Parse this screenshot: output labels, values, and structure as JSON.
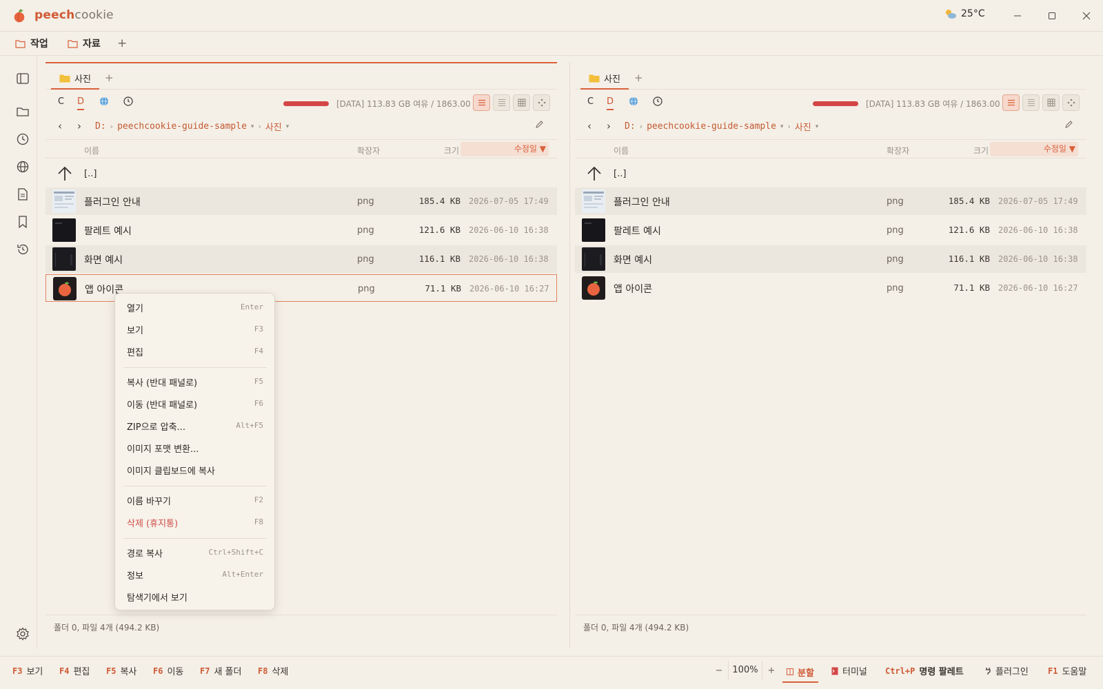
{
  "app": {
    "name_brand": "peech",
    "name_rest": "cookie"
  },
  "weather": {
    "icon": "partly-cloudy-icon",
    "temperature": "25°C"
  },
  "workspace_tabs": [
    {
      "label": "작업",
      "icon": "folder-icon"
    },
    {
      "label": "자료",
      "icon": "folder-icon"
    }
  ],
  "workspace_add": "+",
  "colors": {
    "accent": "#d9603b",
    "usage_bar": "#d44646",
    "background": "#f4efe7"
  },
  "panels": [
    {
      "tab_label": "사진",
      "tab_add": "+",
      "drives": [
        "C",
        "D"
      ],
      "active_drive": "D",
      "usage_text": "[DATA] 113.83 GB 여유 / 1863.00 GB",
      "usage_fraction": 0.939,
      "path": {
        "root": "D:",
        "folder": "peechcookie-guide-sample",
        "current": "사진"
      },
      "columns": {
        "name": "이름",
        "ext": "확장자",
        "size": "크기",
        "modified": "수정일 ▼"
      },
      "parent_label": "[..]",
      "files": [
        {
          "name": "플러그인 안내",
          "ext": "png",
          "size": "185.4 KB",
          "date": "2026-07-05 17:49"
        },
        {
          "name": "팔레트 예시",
          "ext": "png",
          "size": "121.6 KB",
          "date": "2026-06-10 16:38"
        },
        {
          "name": "화면 예시",
          "ext": "png",
          "size": "116.1 KB",
          "date": "2026-06-10 16:38"
        },
        {
          "name": "앱 아이콘",
          "ext": "png",
          "size": "71.1 KB",
          "date": "2026-06-10 16:27"
        }
      ],
      "status": "폴더 0, 파일 4개 (494.2 KB)"
    },
    {
      "tab_label": "사진",
      "tab_add": "+",
      "drives": [
        "C",
        "D"
      ],
      "active_drive": "D",
      "usage_text": "[DATA] 113.83 GB 여유 / 1863.00 GB",
      "usage_fraction": 0.939,
      "path": {
        "root": "D:",
        "folder": "peechcookie-guide-sample",
        "current": "사진"
      },
      "columns": {
        "name": "이름",
        "ext": "확장자",
        "size": "크기",
        "modified": "수정일 ▼"
      },
      "parent_label": "[..]",
      "files": [
        {
          "name": "플러그인 안내",
          "ext": "png",
          "size": "185.4 KB",
          "date": "2026-07-05 17:49"
        },
        {
          "name": "팔레트 예시",
          "ext": "png",
          "size": "121.6 KB",
          "date": "2026-06-10 16:38"
        },
        {
          "name": "화면 예시",
          "ext": "png",
          "size": "116.1 KB",
          "date": "2026-06-10 16:38"
        },
        {
          "name": "앱 아이콘",
          "ext": "png",
          "size": "71.1 KB",
          "date": "2026-06-10 16:27"
        }
      ],
      "status": "폴더 0, 파일 4개 (494.2 KB)"
    }
  ],
  "context_menu": {
    "items": [
      {
        "label": "열기",
        "key": "Enter"
      },
      {
        "label": "보기",
        "key": "F3"
      },
      {
        "label": "편집",
        "key": "F4"
      },
      {
        "label": "복사 (반대 패널로)",
        "key": "F5"
      },
      {
        "label": "이동 (반대 패널로)",
        "key": "F6"
      },
      {
        "label": "ZIP으로 압축...",
        "key": "Alt+F5"
      },
      {
        "label": "이미지 포맷 변환...",
        "key": ""
      },
      {
        "label": "이미지 클립보드에 복사",
        "key": ""
      },
      {
        "label": "이름 바꾸기",
        "key": "F2"
      },
      {
        "label": "삭제 (휴지통)",
        "key": "F8"
      },
      {
        "label": "경로 복사",
        "key": "Ctrl+Shift+C"
      },
      {
        "label": "정보",
        "key": "Alt+Enter"
      },
      {
        "label": "탐색기에서 보기",
        "key": ""
      }
    ]
  },
  "function_keys": [
    {
      "key": "F3",
      "label": "보기"
    },
    {
      "key": "F4",
      "label": "편집"
    },
    {
      "key": "F5",
      "label": "복사"
    },
    {
      "key": "F6",
      "label": "이동"
    },
    {
      "key": "F7",
      "label": "새 폴더"
    },
    {
      "key": "F8",
      "label": "삭제"
    }
  ],
  "zoom": {
    "minus": "−",
    "value": "100%",
    "plus": "+"
  },
  "right_actions": {
    "split": "분할",
    "terminal": "터미널",
    "palette_key": "Ctrl+P",
    "palette": "명령 팔레트",
    "plugin": "플러그인",
    "help_key": "F1",
    "help": "도움말"
  }
}
